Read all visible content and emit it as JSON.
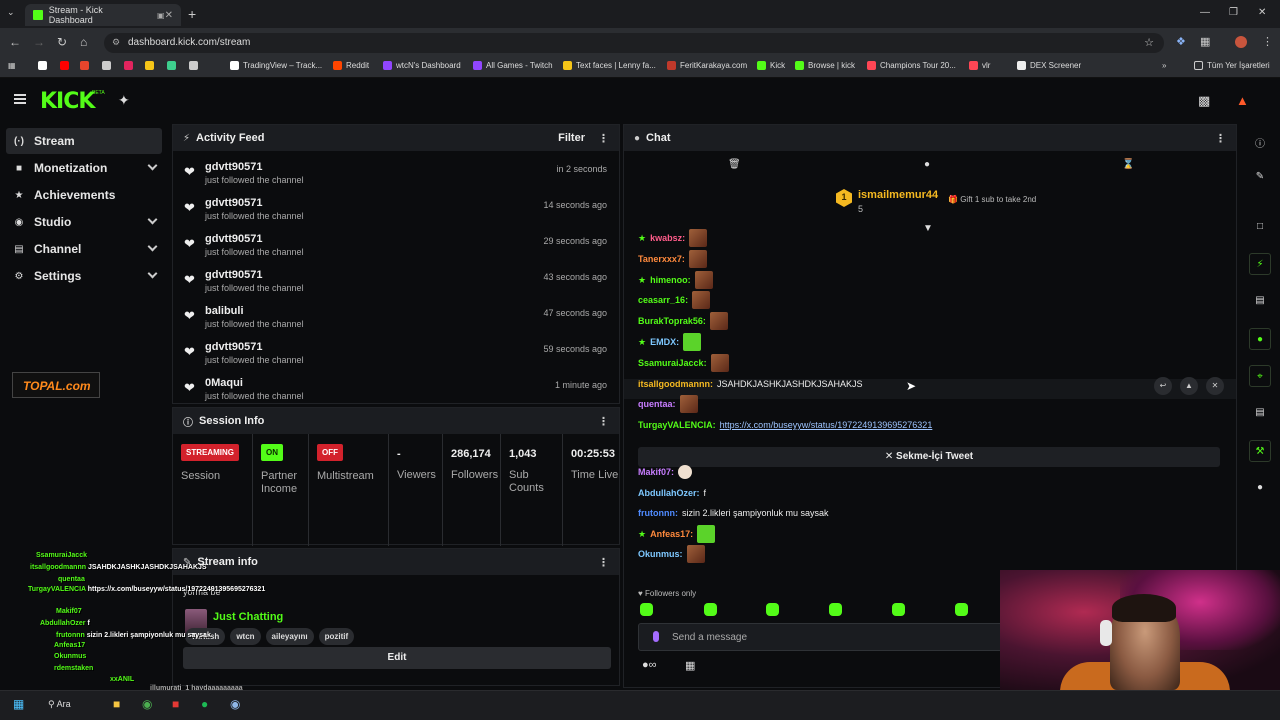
{
  "browser": {
    "tab_title": "Stream - Kick Dashboard",
    "url": "dashboard.kick.com/stream",
    "bookmarks": [
      {
        "label": "",
        "color": "#ffffff"
      },
      {
        "label": "",
        "color": "#ff0000"
      },
      {
        "label": "",
        "color": "#e8452c"
      },
      {
        "label": "",
        "color": "#cccccc"
      },
      {
        "label": "",
        "color": "#e2245e"
      },
      {
        "label": "",
        "color": "#f5c518"
      },
      {
        "label": "",
        "color": "#3ecf8e"
      },
      {
        "label": "",
        "color": "#cccccc"
      },
      {
        "label": "TradingView – Track...",
        "color": "#ffffff"
      },
      {
        "label": "Reddit",
        "color": "#ff4500"
      },
      {
        "label": "wtcN's Dashboard",
        "color": "#9146ff"
      },
      {
        "label": "All Games - Twitch",
        "color": "#9146ff"
      },
      {
        "label": "Text faces | Lenny fa...",
        "color": "#f5c518"
      },
      {
        "label": "FeritKarakaya.com",
        "color": "#c0392b"
      },
      {
        "label": "Kick",
        "color": "#53fc18"
      },
      {
        "label": "Browse | kick",
        "color": "#53fc18"
      },
      {
        "label": "Champions Tour 20...",
        "color": "#ff4655"
      },
      {
        "label": "vlr",
        "color": "#ff4655"
      },
      {
        "label": "DEX Screener",
        "color": "#eeeeee"
      }
    ],
    "bookmarks_folder": "Tüm Yer İşaretleri"
  },
  "header": {
    "logo": "KICK",
    "beta": "BETA"
  },
  "sidebar": {
    "items": [
      {
        "label": "Stream",
        "icon": "stream-icon",
        "active": true,
        "expandable": false
      },
      {
        "label": "Monetization",
        "icon": "monetization-icon",
        "active": false,
        "expandable": true
      },
      {
        "label": "Achievements",
        "icon": "trophy-icon",
        "active": false,
        "expandable": false
      },
      {
        "label": "Studio",
        "icon": "studio-icon",
        "active": false,
        "expandable": true
      },
      {
        "label": "Channel",
        "icon": "channel-icon",
        "active": false,
        "expandable": true
      },
      {
        "label": "Settings",
        "icon": "gear-icon",
        "active": false,
        "expandable": true
      }
    ]
  },
  "activity_feed": {
    "title": "Activity Feed",
    "filter_label": "Filter",
    "items": [
      {
        "name": "gdvtt90571",
        "action": "just followed the channel",
        "time": "in 2 seconds"
      },
      {
        "name": "gdvtt90571",
        "action": "just followed the channel",
        "time": "14 seconds ago"
      },
      {
        "name": "gdvtt90571",
        "action": "just followed the channel",
        "time": "29 seconds ago"
      },
      {
        "name": "gdvtt90571",
        "action": "just followed the channel",
        "time": "43 seconds ago"
      },
      {
        "name": "balibuli",
        "action": "just followed the channel",
        "time": "47 seconds ago"
      },
      {
        "name": "gdvtt90571",
        "action": "just followed the channel",
        "time": "59 seconds ago"
      },
      {
        "name": "0Maqui",
        "action": "just followed the channel",
        "time": "1 minute ago"
      }
    ]
  },
  "session_info": {
    "title": "Session Info",
    "stats": [
      {
        "badge": "STREAMING",
        "badge_color": "red",
        "label": "Session"
      },
      {
        "badge": "ON",
        "badge_color": "green",
        "label": "Partner Income"
      },
      {
        "badge": "OFF",
        "badge_color": "red",
        "label": "Multistream"
      },
      {
        "value": "-",
        "label": "Viewers"
      },
      {
        "value": "286,174",
        "label": "Followers"
      },
      {
        "value": "1,043",
        "label": "Sub Counts"
      },
      {
        "value": "00:25:53",
        "label": "Time Live"
      }
    ]
  },
  "stream_info": {
    "title": "Stream info",
    "stream_title": "yorma be",
    "category": "Just Chatting",
    "tags": [
      "Turkish",
      "wtcn",
      "aileyayını",
      "pozitif"
    ],
    "edit_label": "Edit"
  },
  "chat": {
    "title": "Chat",
    "pinned": {
      "rank": "1",
      "user": "ismailmemur44",
      "count": "5",
      "gift_text": "Gift 1 sub to take 2nd"
    },
    "messages": [
      {
        "user": "kwabsz",
        "color": "#ff5c8a",
        "text": "",
        "emote": "brown",
        "mod": true
      },
      {
        "user": "Tanerxxx7",
        "color": "#ff8a3d",
        "text": "",
        "emote": "brown",
        "mod": false
      },
      {
        "user": "himenoo",
        "color": "#53fc18",
        "text": "",
        "emote": "brown",
        "mod": true
      },
      {
        "user": "ceasarr_16",
        "color": "#53fc18",
        "text": "",
        "emote": "brown",
        "mod": false
      },
      {
        "user": "BurakToprak56",
        "color": "#53fc18",
        "text": "",
        "emote": "brown",
        "mod": false
      },
      {
        "user": "EMDX",
        "color": "#7ec8ff",
        "text": "",
        "emote": "green",
        "mod": true
      },
      {
        "user": "SsamuraiJacck",
        "color": "#53fc18",
        "text": "",
        "emote": "brown",
        "mod": false
      },
      {
        "user": "itsallgoodmannn",
        "color": "#f5b921",
        "text": "JSAHDKJASHKJASHDKJSAHAKJS",
        "emote": "",
        "mod": false
      },
      {
        "user": "quentaa",
        "color": "#c77dff",
        "text": "",
        "emote": "brown",
        "mod": false
      },
      {
        "user": "TurgayVALENCIA",
        "color": "#53fc18",
        "text": "",
        "link": "https://x.com/buseyyw/status/1972249139695276321",
        "emote": "",
        "mod": false
      },
      {
        "user": "Makif07",
        "color": "#c77dff",
        "text": "",
        "emote": "face",
        "mod": false
      },
      {
        "user": "AbdullahOzer",
        "color": "#7ec8ff",
        "text": "f",
        "emote": "",
        "mod": false
      },
      {
        "user": "frutonnn",
        "color": "#4f8bff",
        "text": "sizin 2.likleri şampiyonluk mu saysak",
        "emote": "",
        "mod": false
      },
      {
        "user": "Anfeas17",
        "color": "#ff8a3d",
        "text": "",
        "emote": "green",
        "mod": true
      },
      {
        "user": "Okunmus",
        "color": "#7ec8ff",
        "text": "",
        "emote": "brown",
        "mod": false
      }
    ],
    "tweet_button": "Sekme-İçi Tweet",
    "followers_only": "Followers only",
    "input_placeholder": "Send a message"
  },
  "overlay_chat": {
    "lines": [
      {
        "user": "SsamuraiJacck",
        "text": ""
      },
      {
        "user": "itsallgoodmannn",
        "text": "JSAHDKJASHKJASHDKJSAHAKJS"
      },
      {
        "user": "quentaa",
        "text": ""
      },
      {
        "user": "TurgayVALENCIA",
        "text": "https://x.com/buseyyw/status/19722491395695276321"
      },
      {
        "user": "Makif07",
        "text": ""
      },
      {
        "user": "AbdullahOzer",
        "text": "f"
      },
      {
        "user": "frutonnn",
        "text": "sizin 2.likleri şampiyonluk mu saysak"
      },
      {
        "user": "Anfeas17",
        "text": ""
      },
      {
        "user": "Okunmus",
        "text": ""
      },
      {
        "user": "rdemstaken",
        "text": ""
      },
      {
        "user": "xxANIL",
        "text": ""
      }
    ],
    "overflow_tail": "illumurati_1  haydaaaaaaaaa"
  },
  "taskbar": {
    "search_label": "Ara"
  },
  "colors": {
    "kick_green": "#53fc18",
    "background": "#0b0c0e",
    "panel_header": "#1b1d21",
    "streaming_red": "#d3222c"
  }
}
